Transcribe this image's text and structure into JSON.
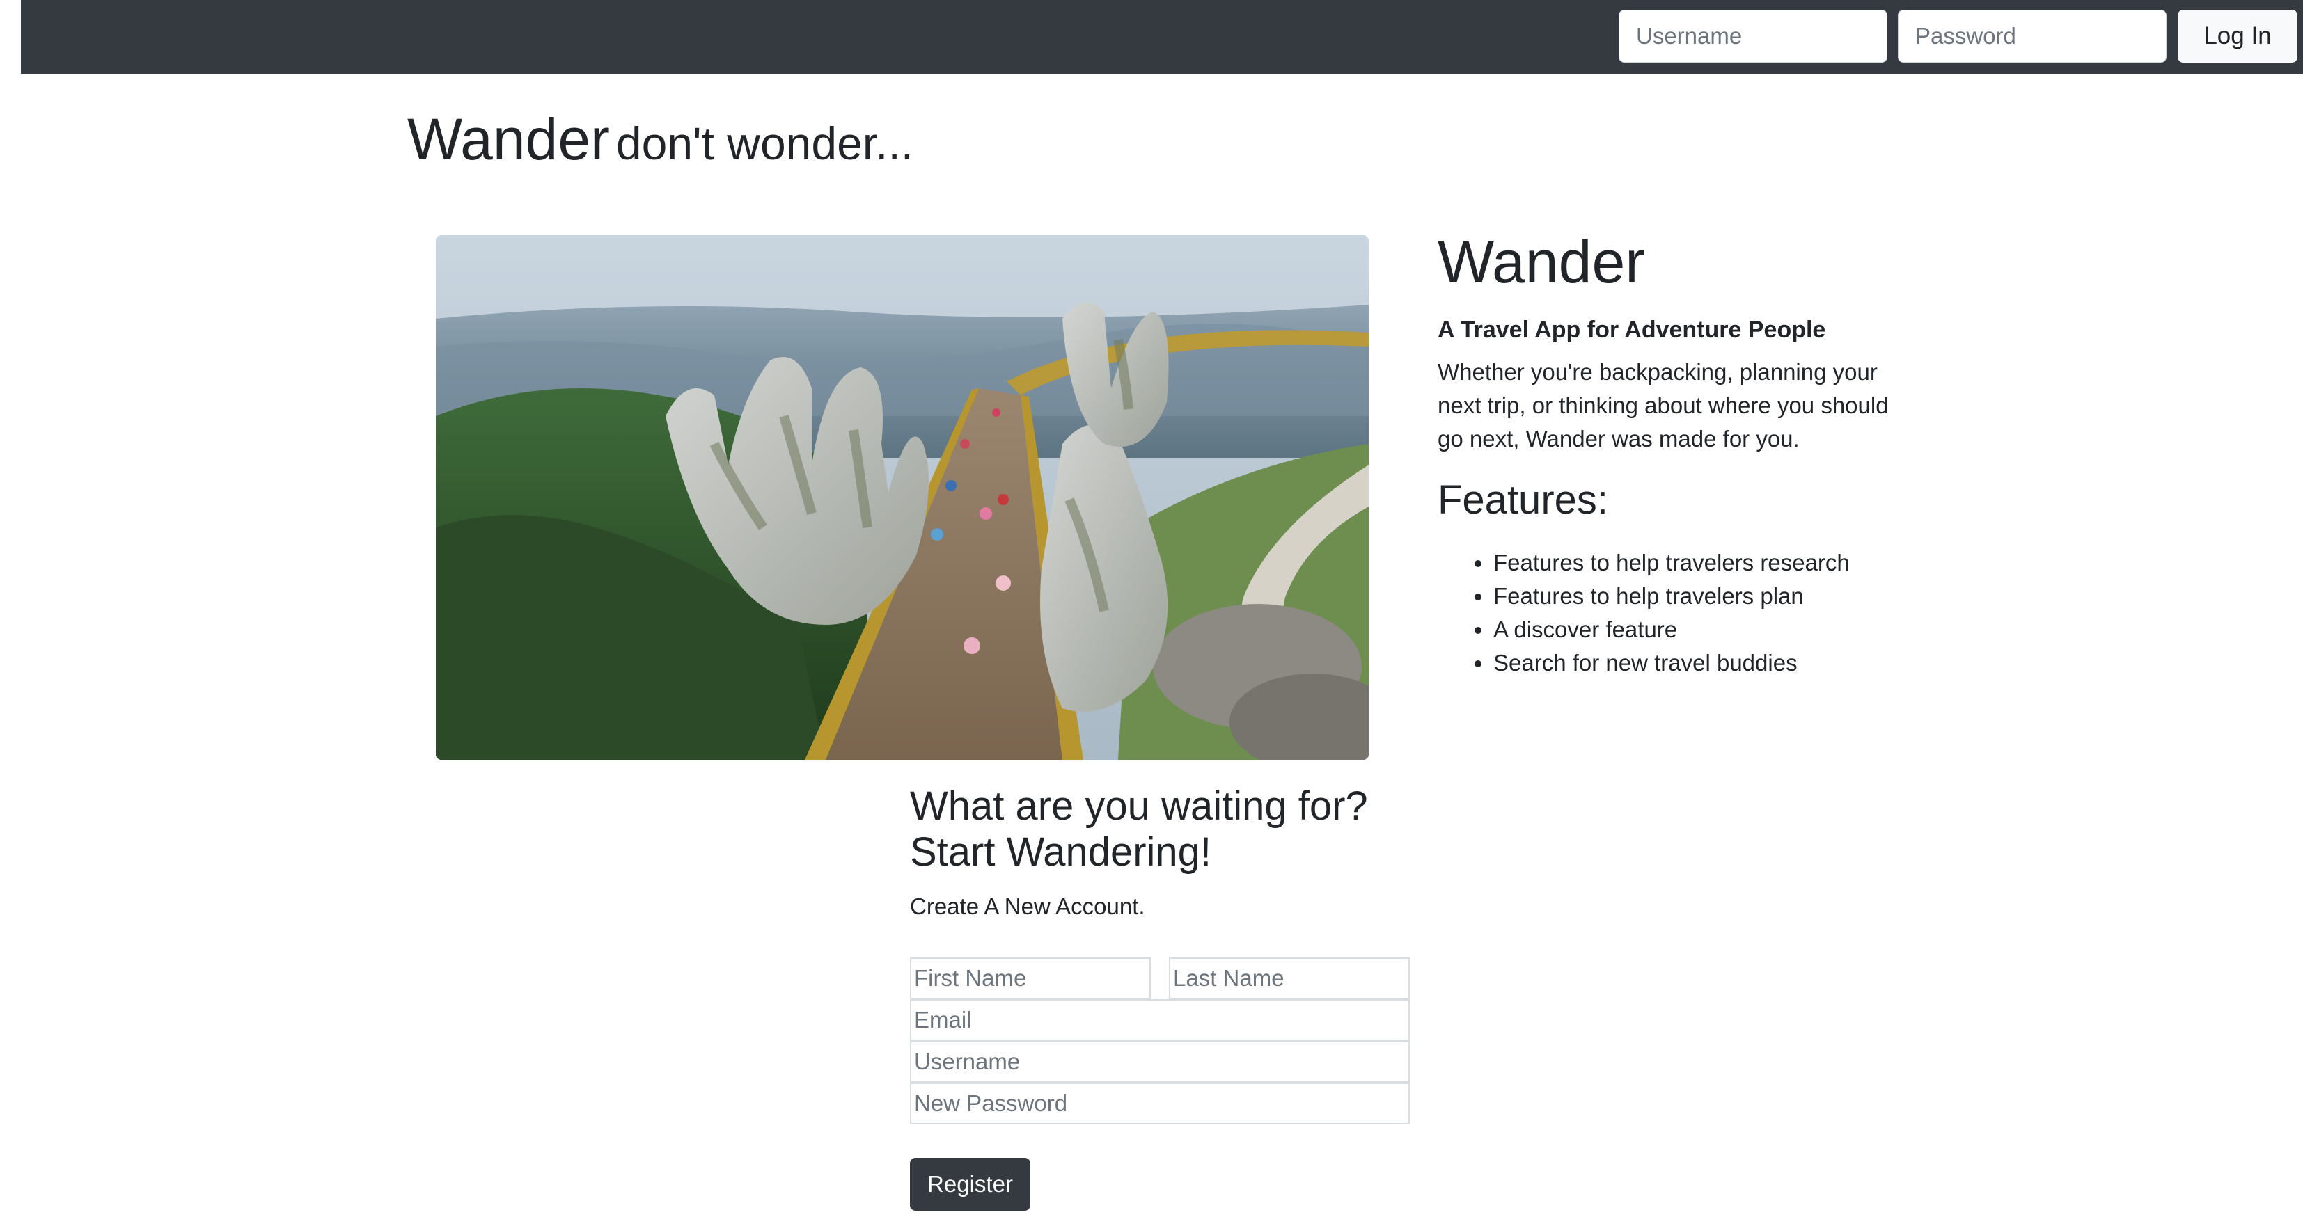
{
  "navbar": {
    "username_placeholder": "Username",
    "password_placeholder": "Password",
    "login_label": "Log In"
  },
  "heading": {
    "brand": "Wander",
    "tagline": "don't wonder..."
  },
  "hero": {
    "description": "Aerial photo of a golden footbridge held up by two giant stone hands above forested mountains"
  },
  "about": {
    "title": "Wander",
    "subtitle": "A Travel App for Adventure People",
    "description": "Whether you're backpacking, planning your next trip, or thinking about where you should go next, Wander was made for you."
  },
  "features": {
    "title": "Features:",
    "items": [
      "Features to help travelers research",
      "Features to help travelers plan",
      "A discover feature",
      "Search for new travel buddies"
    ]
  },
  "register": {
    "title_line1": "What are you waiting for?",
    "title_line2": "Start Wandering!",
    "subtitle": "Create A New Account.",
    "first_name_placeholder": "First Name",
    "last_name_placeholder": "Last Name",
    "email_placeholder": "Email",
    "username_placeholder": "Username",
    "password_placeholder": "New Password",
    "button_label": "Register"
  },
  "colors": {
    "navbar_bg": "#343a40",
    "button_dark": "#343a40",
    "button_light": "#f8f9fa",
    "text": "#212529"
  }
}
